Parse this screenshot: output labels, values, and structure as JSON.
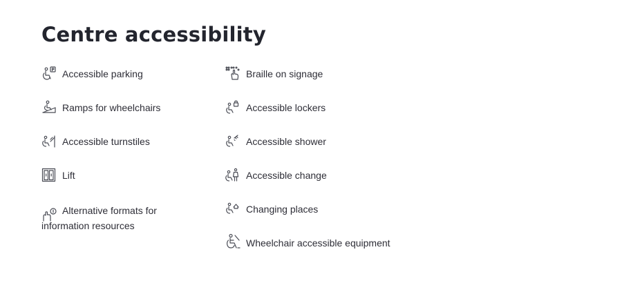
{
  "title": "Centre accessibility",
  "left_column": [
    {
      "label": "Accessible parking",
      "icon": "accessible-parking-icon"
    },
    {
      "label": "Ramps for wheelchairs",
      "icon": "ramp-icon"
    },
    {
      "label": "Accessible turnstiles",
      "icon": "turnstile-icon"
    },
    {
      "label": "Lift",
      "icon": "lift-icon"
    },
    {
      "label": "Alternative formats for information resources",
      "icon": "alternative-formats-icon"
    }
  ],
  "right_column": [
    {
      "label": "Braille on signage",
      "icon": "braille-icon"
    },
    {
      "label": "Accessible lockers",
      "icon": "locker-icon"
    },
    {
      "label": "Accessible shower",
      "icon": "shower-icon"
    },
    {
      "label": "Accessible change",
      "icon": "change-room-icon"
    },
    {
      "label": "Changing places",
      "icon": "changing-places-icon"
    },
    {
      "label": "Wheelchair accessible equipment",
      "icon": "wheelchair-equipment-icon"
    }
  ]
}
